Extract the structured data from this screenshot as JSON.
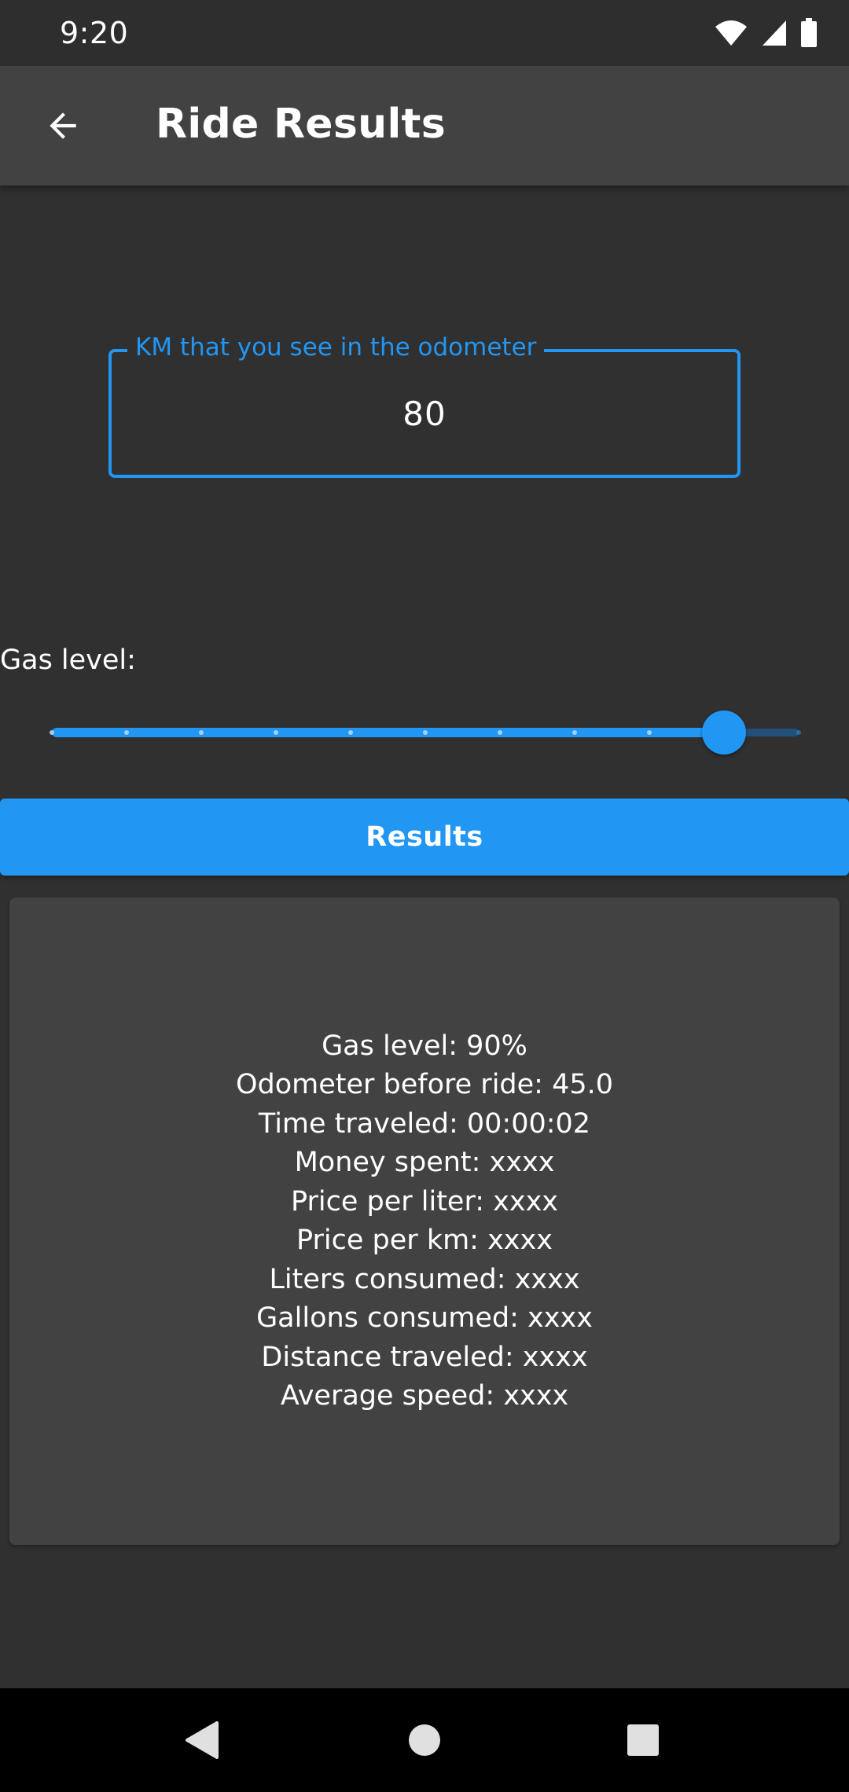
{
  "status_bar": {
    "time": "9:20",
    "icons": [
      "wifi-icon",
      "signal-icon",
      "battery-icon"
    ]
  },
  "app_bar": {
    "back_icon": "arrow-back-icon",
    "title": "Ride Results"
  },
  "odometer_field": {
    "label": "KM that you see in the odometer",
    "value": "80",
    "accent_color": "#2196f3"
  },
  "gas_level": {
    "label": "Gas level:",
    "slider_value_fraction": 0.9,
    "slider_divisions": 10
  },
  "results_button": {
    "label": "Results",
    "color": "#2196f3"
  },
  "results_card": {
    "lines": [
      "Gas level: 90%",
      "Odometer before ride: 45.0",
      "Time traveled: 00:00:02",
      "Money spent: xxxx",
      "Price per liter: xxxx",
      "Price per km: xxxx",
      "Liters consumed: xxxx",
      "Gallons consumed: xxxx",
      "Distance traveled: xxxx",
      "Average speed: xxxx"
    ]
  },
  "nav_bar": {
    "buttons": [
      "nav-back-icon",
      "nav-home-icon",
      "nav-recents-icon"
    ]
  },
  "colors": {
    "background": "#303030",
    "surface": "#424242",
    "accent": "#2196f3"
  }
}
